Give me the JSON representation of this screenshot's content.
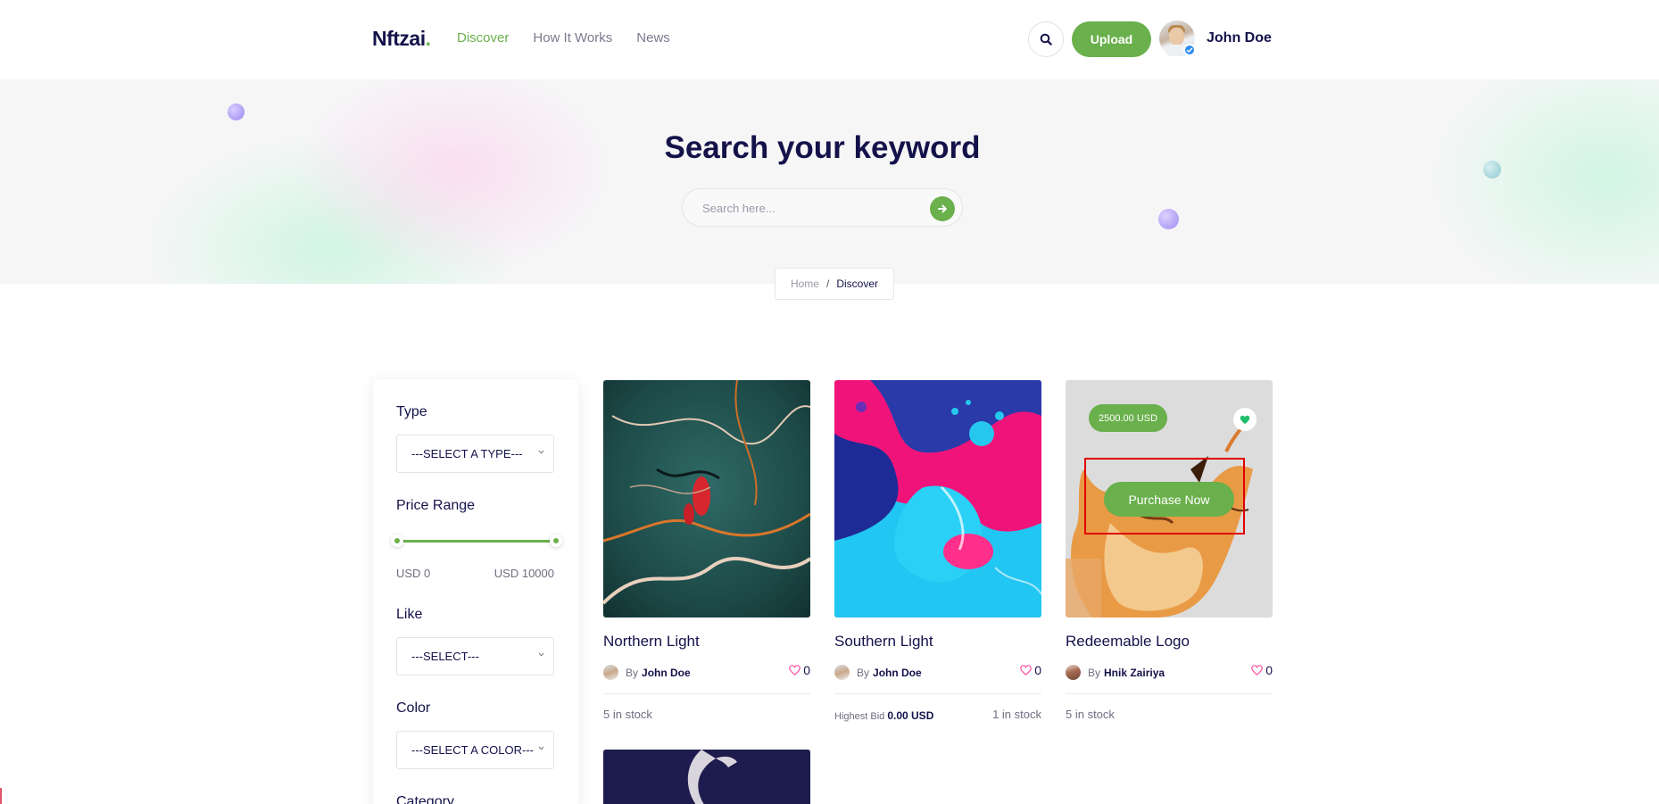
{
  "header": {
    "logo": "Nftzai",
    "logo_dot": ".",
    "nav": [
      {
        "label": "Discover",
        "active": true
      },
      {
        "label": "How It Works",
        "active": false
      },
      {
        "label": "News",
        "active": false
      }
    ],
    "upload_label": "Upload",
    "user_name": "John Doe"
  },
  "hero": {
    "title": "Search your keyword",
    "search_placeholder": "Search here..."
  },
  "breadcrumb": {
    "home": "Home",
    "separator": "/",
    "current": "Discover"
  },
  "filters": {
    "type_label": "Type",
    "type_select": "---SELECT A TYPE---",
    "price_label": "Price Range",
    "price_min": "USD 0",
    "price_max": "USD 10000",
    "like_label": "Like",
    "like_select": "---SELECT---",
    "color_label": "Color",
    "color_select": "---SELECT A COLOR---",
    "category_label": "Category"
  },
  "cards": [
    {
      "title": "Northern Light",
      "by": "By",
      "author": "John Doe",
      "likes": "0",
      "stock": "5 in stock"
    },
    {
      "title": "Southern Light",
      "by": "By",
      "author": "John Doe",
      "likes": "0",
      "bid_label": "Highest Bid",
      "bid_value": "0.00 USD",
      "stock": "1 in stock"
    },
    {
      "title": "Redeemable Logo",
      "by": "By",
      "author": "Hnik Zairiya",
      "likes": "0",
      "stock": "5 in stock",
      "price_badge": "2500.00 USD",
      "purchase_label": "Purchase Now"
    }
  ],
  "colors": {
    "accent": "#6ab04c",
    "text_dark": "#14124a",
    "highlight_box": "#e00000"
  }
}
